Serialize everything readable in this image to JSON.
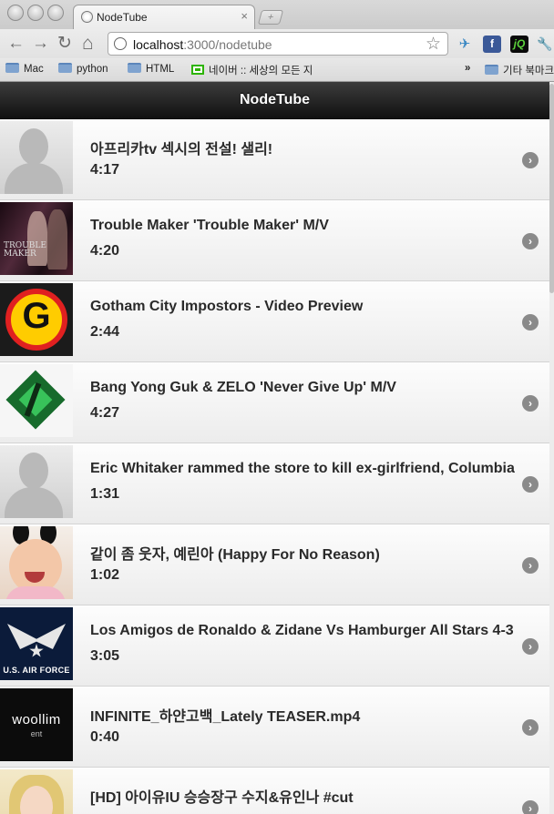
{
  "browser": {
    "tab_title": "NodeTube",
    "tab_close": "×",
    "newtab_glyph": "+",
    "url_host": "localhost",
    "url_rest": ":3000/nodetube",
    "back_glyph": "←",
    "forward_glyph": "→",
    "reload_glyph": "↻",
    "home_glyph": "⌂",
    "star_glyph": "☆",
    "wrench_glyph": "🔧",
    "extensions": {
      "facebook": "f",
      "jquery": "jQ"
    },
    "bookmarks": [
      "Mac",
      "python",
      "HTML",
      "네이버 :: 세상의 모든 지",
      "기타 북마크"
    ],
    "bookmarks_overflow": "»"
  },
  "page": {
    "header_title": "NodeTube",
    "chevron_glyph": "›"
  },
  "thumbnail_text": {
    "trouble": "TROUBLE\nMAKER",
    "gotham": "G",
    "air_force": "U.S. AIR FORCE",
    "woollim": "woollim",
    "woollim_sub": "ent"
  },
  "videos": [
    {
      "title": "아프리카tv 섹시의 전설! 샐리!",
      "duration": "4:17",
      "thumb": "default"
    },
    {
      "title": "Trouble Maker 'Trouble Maker' M/V",
      "duration": "4:20",
      "thumb": "trouble"
    },
    {
      "title": "Gotham City Impostors - Video Preview",
      "duration": "2:44",
      "thumb": "gotham"
    },
    {
      "title": "Bang Yong Guk & ZELO 'Never Give Up' M/V",
      "duration": "4:27",
      "thumb": "bang"
    },
    {
      "title": "Eric Whitaker rammed the store to kill ex-girlfriend, Columbia",
      "duration": "1:31",
      "thumb": "default"
    },
    {
      "title": "같이 좀 웃자, 예린아 (Happy For No Reason)",
      "duration": "1:02",
      "thumb": "baby"
    },
    {
      "title": "Los Amigos de Ronaldo & Zidane Vs Hamburger All Stars 4-3",
      "duration": "3:05",
      "thumb": "air"
    },
    {
      "title": "INFINITE_하얀고백_Lately TEASER.mp4",
      "duration": "0:40",
      "thumb": "woollim"
    },
    {
      "title": "[HD] 아이유IU 승승장구 수지&유인나 #cut",
      "duration": "",
      "thumb": "iu"
    }
  ]
}
